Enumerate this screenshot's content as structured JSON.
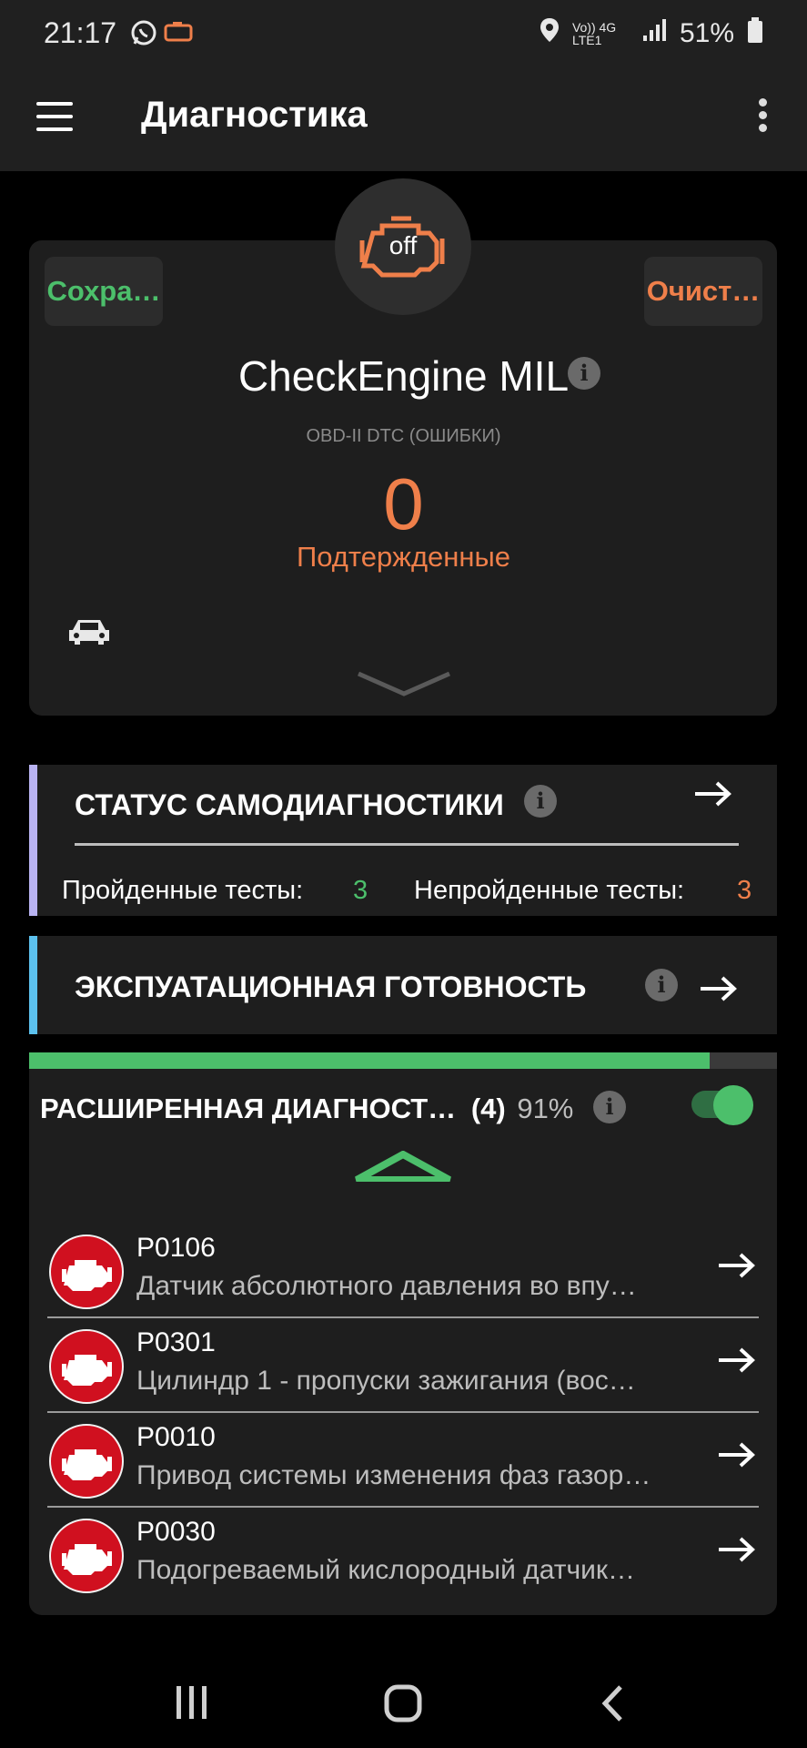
{
  "status_bar": {
    "time": "21:17",
    "network": "Vo)) 4G LTE1",
    "battery": "51%"
  },
  "app_bar": {
    "title": "Диагностика",
    "menu_icon": "hamburger-icon",
    "more_icon": "more-vert-icon"
  },
  "check_engine": {
    "save_label": "Сохра…",
    "clear_label": "Очист…",
    "indicator": "off",
    "title": "CheckEngine MIL",
    "subtitle": "OBD-II DTC (ОШИБКИ)",
    "count": "0",
    "count_label": "Подтержденные"
  },
  "self_diag": {
    "title": "СТАТУС САМОДИАГНОСТИКИ",
    "passed_label": "Пройденные тесты:",
    "passed_value": "3",
    "failed_label": "Непройденные тесты:",
    "failed_value": "3",
    "accent": "#b9b3f2"
  },
  "readiness": {
    "title": "ЭКСПУАТАЦИОННАЯ ГОТОВНОСТЬ",
    "accent": "#5cc1ee"
  },
  "extended": {
    "title": "РАСШИРЕННАЯ ДИАГНОСТ…",
    "count": "(4)",
    "percent": "91%",
    "progress_fraction": 0.91,
    "toggle_on": true,
    "items": [
      {
        "code": "P0106",
        "desc": "Датчик абсолютного давления во впу…"
      },
      {
        "code": "P0301",
        "desc": "Цилиндр 1 - пропуски зажигания (вос…"
      },
      {
        "code": "P0010",
        "desc": "Привод системы изменения фаз газор…"
      },
      {
        "code": "P0030",
        "desc": "Подогреваемый кислородный датчик…"
      }
    ]
  },
  "colors": {
    "green": "#4cbf6b",
    "orange": "#ef7f4a",
    "red": "#d0101f"
  }
}
